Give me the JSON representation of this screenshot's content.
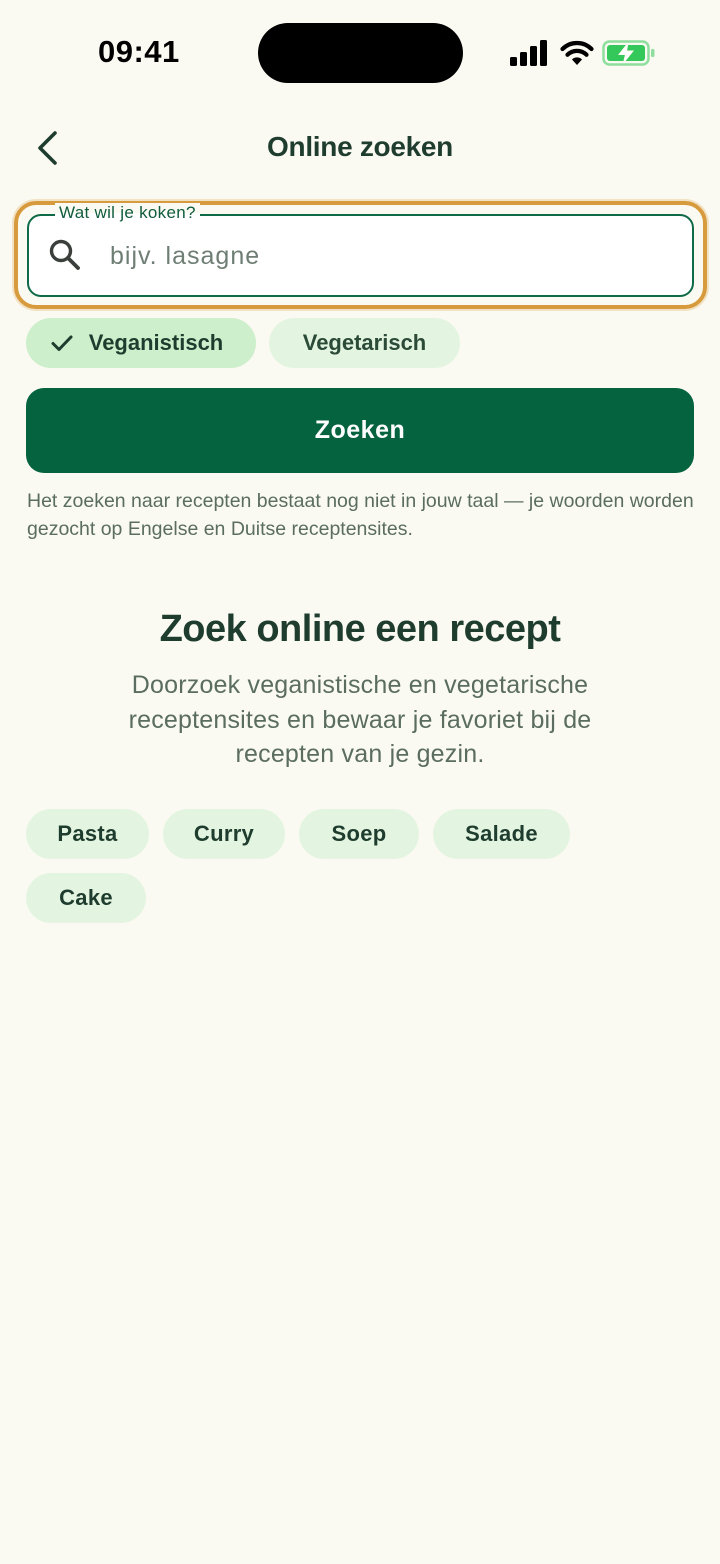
{
  "status_bar": {
    "time": "09:41",
    "icons": [
      "cellular-signal-icon",
      "wifi-icon",
      "battery-charging-icon"
    ],
    "battery_color": "#34C759"
  },
  "header": {
    "back_icon": "chevron-left-icon",
    "title": "Online zoeken"
  },
  "search": {
    "label": "Wat wil je koken?",
    "placeholder": "bijv. lasagne",
    "value": "",
    "icon": "search-icon",
    "focus_color": "#D79A3C",
    "border_color": "#0F6A47"
  },
  "diet_filters": [
    {
      "label": "Veganistisch",
      "selected": true,
      "icon": "check-icon"
    },
    {
      "label": "Vegetarisch",
      "selected": false
    }
  ],
  "search_button": {
    "label": "Zoeken",
    "color": "#05633F"
  },
  "language_note": "Het zoeken naar recepten bestaat nog niet in jouw taal — je woorden worden gezocht op Engelse en Duitse receptensites.",
  "empty_state": {
    "title": "Zoek online een recept",
    "description": "Doorzoek veganistische en vegetarische receptensites en bewaar je favoriet bij de recepten van je gezin."
  },
  "suggestions": [
    "Pasta",
    "Curry",
    "Soep",
    "Salade",
    "Cake"
  ]
}
